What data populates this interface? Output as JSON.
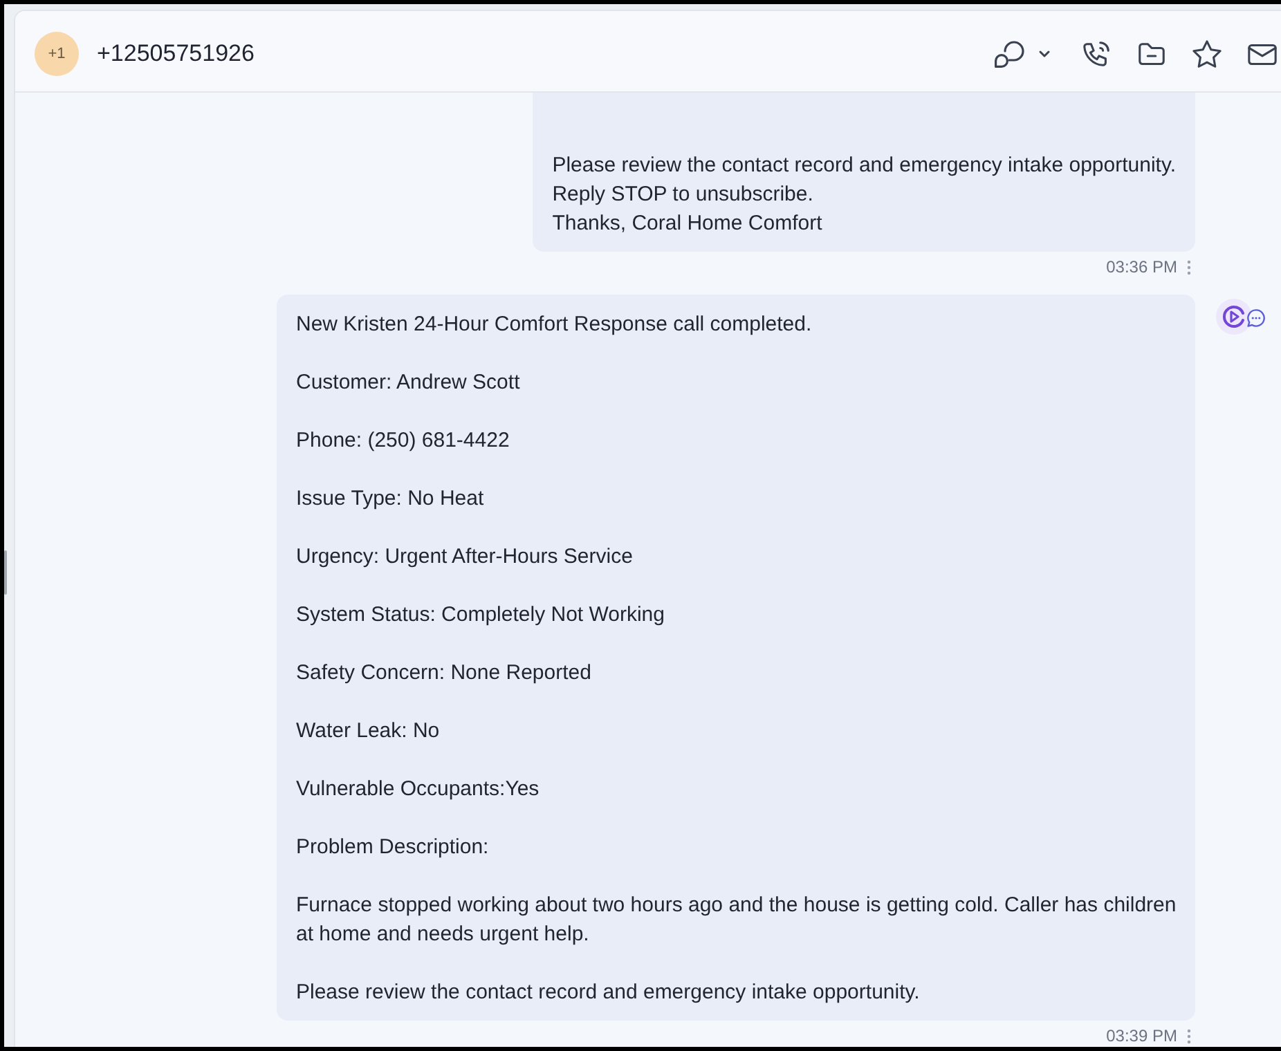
{
  "header": {
    "avatar_text": "+1",
    "title": "+12505751926"
  },
  "messages": [
    {
      "cut_off_top": true,
      "sender_icon": false,
      "paragraphs": [
        [
          "Please review the contact record and emergency intake opportunity.",
          "Reply STOP to unsubscribe.",
          "Thanks, Coral Home Comfort"
        ]
      ],
      "time": "03:36 PM"
    },
    {
      "cut_off_top": false,
      "sender_icon": true,
      "paragraphs": [
        [
          "New Kristen 24-Hour Comfort Response call completed."
        ],
        [
          "Customer: Andrew Scott"
        ],
        [
          "Phone: (250) 681-4422"
        ],
        [
          "Issue Type: No Heat"
        ],
        [
          "Urgency: Urgent After-Hours Service"
        ],
        [
          "System Status: Completely Not Working"
        ],
        [
          "Safety Concern: None Reported"
        ],
        [
          "Water Leak: No"
        ],
        [
          "Vulnerable Occupants:Yes"
        ],
        [
          "Problem Description:"
        ],
        [
          "Furnace stopped working about two hours ago and the house is getting cold. Caller has children at home and needs urgent help."
        ],
        [
          "Please review the contact record and emergency intake opportunity."
        ]
      ],
      "time": "03:39 PM"
    }
  ]
}
